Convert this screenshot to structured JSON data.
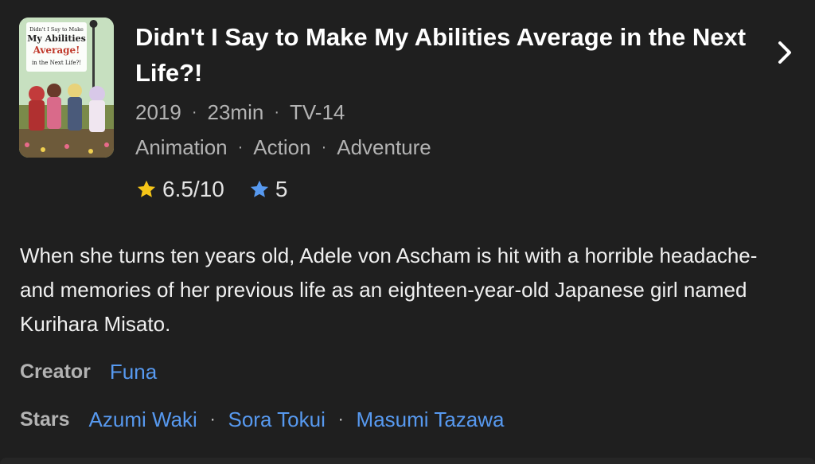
{
  "title": "Didn't I Say to Make My Abilities Average in the Next Life?!",
  "poster": {
    "alt_text_lines": [
      "Didn't I Say to Make",
      "My Abilities",
      "Average!",
      "in the Next Life?!"
    ]
  },
  "meta": {
    "year": "2019",
    "runtime": "23min",
    "rating": "TV-14",
    "separator": "·"
  },
  "genres": [
    "Animation",
    "Action",
    "Adventure"
  ],
  "ratings": {
    "imdb": "6.5/10",
    "user": "5",
    "imdb_star_color": "#f5c518",
    "user_star_color": "#5799ef"
  },
  "synopsis": "When she turns ten years old, Adele von Ascham is hit with a horrible headache-and memories of her previous life as an eighteen-year-old Japanese girl named Kurihara Misato.",
  "credits": {
    "creator_label": "Creator",
    "creators": [
      "Funa"
    ],
    "stars_label": "Stars",
    "stars": [
      "Azumi Waki",
      "Sora Tokui",
      "Masumi Tazawa"
    ]
  },
  "colors": {
    "background": "#1f1f1f",
    "link": "#5799ef",
    "secondary_text": "#b3b3b3"
  },
  "icons": {
    "chevron": "chevron-right-icon",
    "imdb_star": "star-filled-icon",
    "user_star": "star-filled-icon"
  }
}
